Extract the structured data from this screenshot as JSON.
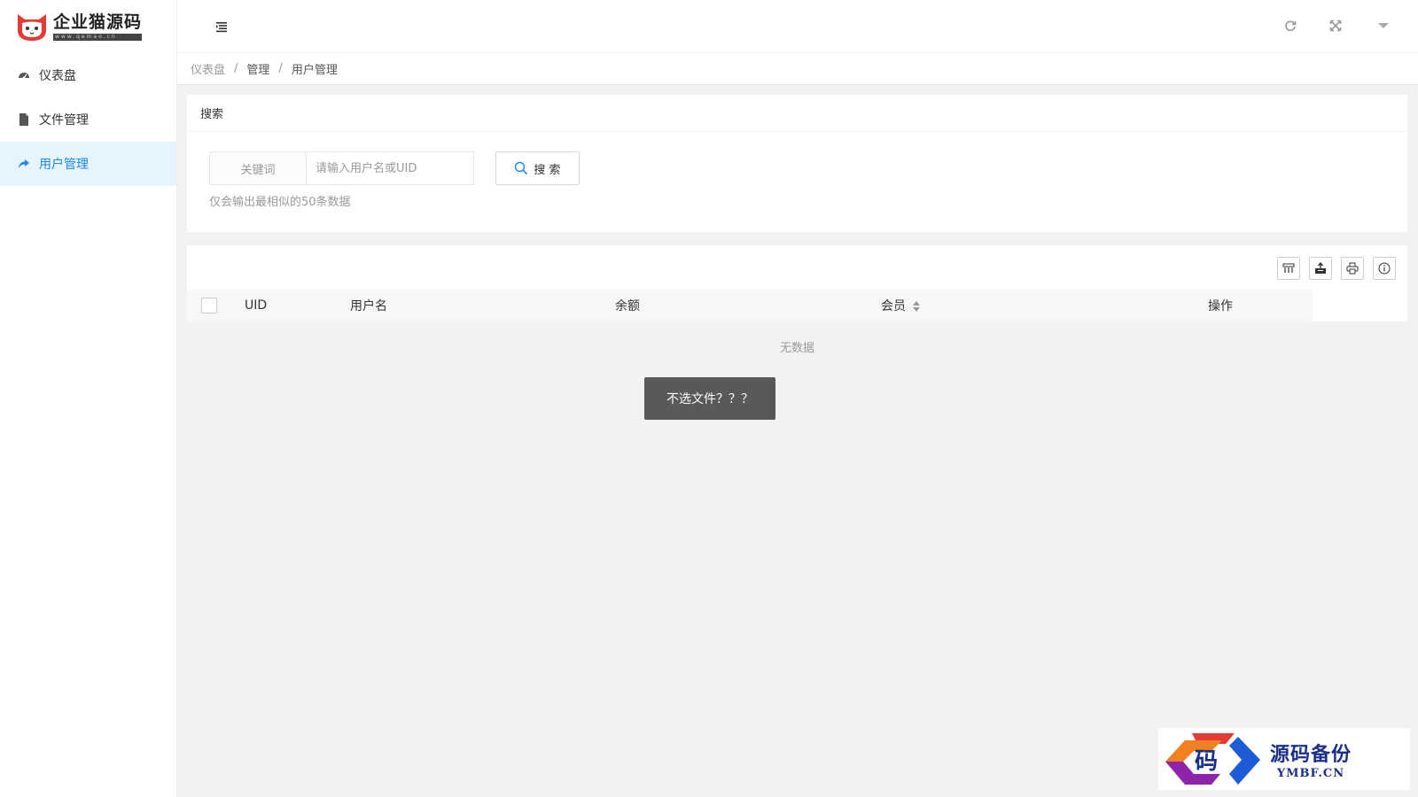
{
  "app": {
    "logo_title": "企业猫源码",
    "logo_sub": "www.qemao.cn"
  },
  "sidebar": {
    "items": [
      {
        "label": "仪表盘",
        "icon": "dashboard-icon"
      },
      {
        "label": "文件管理",
        "icon": "file-icon"
      },
      {
        "label": "用户管理",
        "icon": "share-icon",
        "active": true
      }
    ]
  },
  "topbar": {
    "icons": [
      "menu-toggle-icon",
      "refresh-icon",
      "fullscreen-icon",
      "dropdown-caret-icon"
    ]
  },
  "breadcrumb": {
    "items": [
      "仪表盘",
      "管理",
      "用户管理"
    ],
    "separator": "/"
  },
  "search": {
    "title": "搜索",
    "label": "关键词",
    "placeholder": "请输入用户名或UID",
    "value": "",
    "button_label": "搜 索",
    "hint": "仅会输出最相似的50条数据"
  },
  "table": {
    "toolbar": [
      "columns-icon",
      "export-icon",
      "print-icon",
      "info-icon"
    ],
    "columns": [
      "UID",
      "用户名",
      "余额",
      "会员",
      "操作"
    ],
    "rows": [],
    "empty_text": "无数据"
  },
  "toast": {
    "message": "不选文件？？？"
  },
  "watermark": {
    "glyph": "码",
    "title": "源码备份",
    "domain": "YMBF.CN"
  },
  "colors": {
    "accent": "#1e88e5",
    "active_bg": "#e6f4fd",
    "logo_red": "#e53935",
    "toast_bg": "#595959",
    "watermark_blue": "#1a2f8a"
  }
}
